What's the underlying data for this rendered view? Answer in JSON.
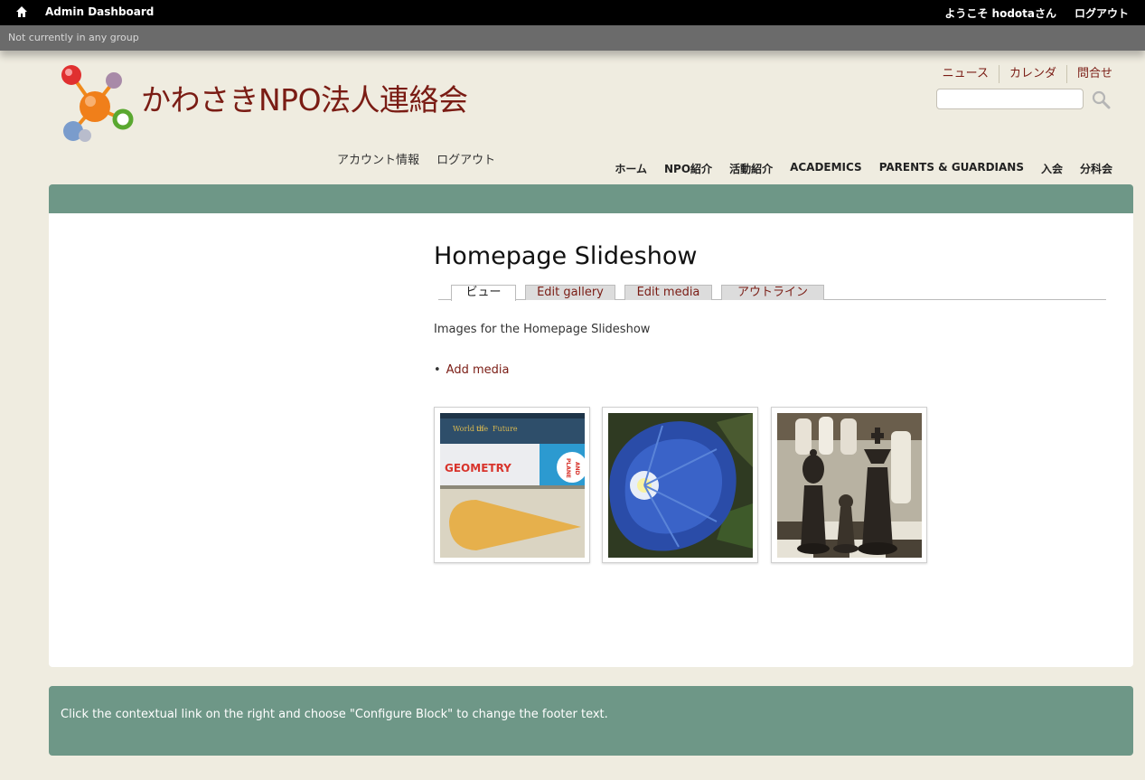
{
  "admin_bar": {
    "dashboard_label": "Admin Dashboard",
    "welcome_text": "ようこそ hodotaさん",
    "logout_label": "ログアウト"
  },
  "group_bar": {
    "text": "Not currently in any group"
  },
  "header": {
    "site_name": "かわさきNPO法人連絡会",
    "secondary_menu": [
      "ニュース",
      "カレンダ",
      "問合せ"
    ],
    "search": {
      "value": "",
      "placeholder": ""
    },
    "user_links": [
      "アカウント情報",
      "ログアウト"
    ],
    "main_menu": [
      "ホーム",
      "NPO紹介",
      "活動紹介",
      "ACADEMICS",
      "PARENTS & GUARDIANS",
      "入会",
      "分科会"
    ]
  },
  "main": {
    "title": "Homepage Slideshow",
    "tabs": [
      {
        "label": "ビュー",
        "active": true
      },
      {
        "label": "Edit gallery",
        "active": false
      },
      {
        "label": "Edit media",
        "active": false
      },
      {
        "label": "アウトライン",
        "active": false
      }
    ],
    "description": "Images for the Homepage Slideshow",
    "add_media_label": "Add media",
    "thumbnails": [
      {
        "subject": "books",
        "text": [
          "GEOMETRY",
          "PLANE",
          "AND",
          "World of",
          "the",
          "Future"
        ]
      },
      {
        "subject": "flower"
      },
      {
        "subject": "chess"
      }
    ]
  },
  "footer": {
    "text": "Click the contextual link on the right and choose \"Configure Block\" to change the footer text."
  },
  "colors": {
    "accent": "#6e9787",
    "link": "#7a1c14",
    "background": "#efece0"
  }
}
